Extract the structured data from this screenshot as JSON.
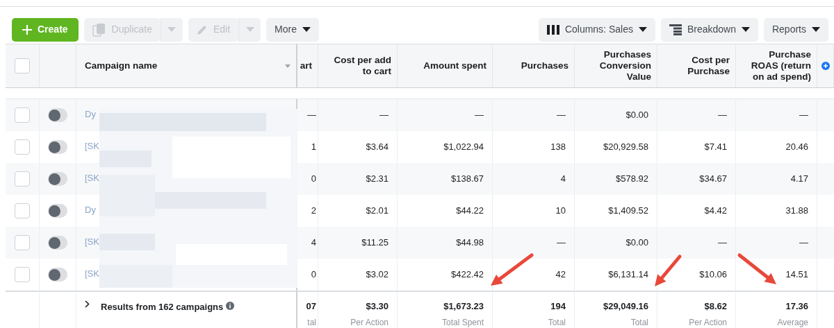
{
  "toolbar": {
    "left": [
      {
        "kind": "primary",
        "label": "Create",
        "disabled": false
      },
      {
        "kind": "split",
        "label": "Duplicate",
        "disabled": true
      },
      {
        "kind": "split",
        "label": "Edit",
        "disabled": true
      },
      {
        "kind": "menu",
        "label": "More",
        "disabled": false
      }
    ],
    "right": [
      {
        "label": "Columns: Sales"
      },
      {
        "label": "Breakdown"
      },
      {
        "label": "Reports"
      }
    ]
  },
  "table": {
    "all_checked": false,
    "name_column": "Campaign name",
    "columns": [
      "art",
      "Cost per add to cart",
      "Amount spent",
      "Purchases",
      "Purchases Conversion Value",
      "Cost per Purchase",
      "Purchase ROAS (return on ad spend)"
    ],
    "rows": [
      {
        "name": "Dy",
        "on": false,
        "checked": false,
        "cells": [
          "—",
          "—",
          "—",
          "—",
          "$0.00",
          "—",
          "—"
        ]
      },
      {
        "name": "[SK",
        "on": false,
        "checked": false,
        "cells": [
          "1",
          "$3.64",
          "$1,022.94",
          "138",
          "$20,929.58",
          "$7.41",
          "20.46"
        ]
      },
      {
        "name": "[SK",
        "on": false,
        "checked": false,
        "cells": [
          "0",
          "$2.31",
          "$138.67",
          "4",
          "$578.92",
          "$34.67",
          "4.17"
        ]
      },
      {
        "name": "Dy",
        "on": false,
        "checked": false,
        "cells": [
          "2",
          "$2.01",
          "$44.22",
          "10",
          "$1,409.52",
          "$4.42",
          "31.88"
        ]
      },
      {
        "name": "[SK",
        "on": false,
        "checked": false,
        "cells": [
          "4",
          "$11.25",
          "$44.98",
          "—",
          "$0.00",
          "—",
          "—"
        ]
      },
      {
        "name": "[SK",
        "on": false,
        "checked": false,
        "cells": [
          "0",
          "$3.02",
          "$422.42",
          "42",
          "$6,131.14",
          "$10.06",
          "14.51"
        ]
      }
    ],
    "summary": {
      "label": "Results from 162 campaigns",
      "cells": [
        {
          "value": "07",
          "caption": "tal"
        },
        {
          "value": "$3.30",
          "caption": "Per Action"
        },
        {
          "value": "$1,673.23",
          "caption": "Total Spent"
        },
        {
          "value": "194",
          "caption": "Total"
        },
        {
          "value": "$29,049.16",
          "caption": "Total"
        },
        {
          "value": "$8.62",
          "caption": "Per Action"
        },
        {
          "value": "17.36",
          "caption": "Average"
        }
      ]
    }
  },
  "annotations": [
    {
      "kind": "arrow"
    },
    {
      "kind": "arrow"
    },
    {
      "kind": "arrow"
    }
  ]
}
